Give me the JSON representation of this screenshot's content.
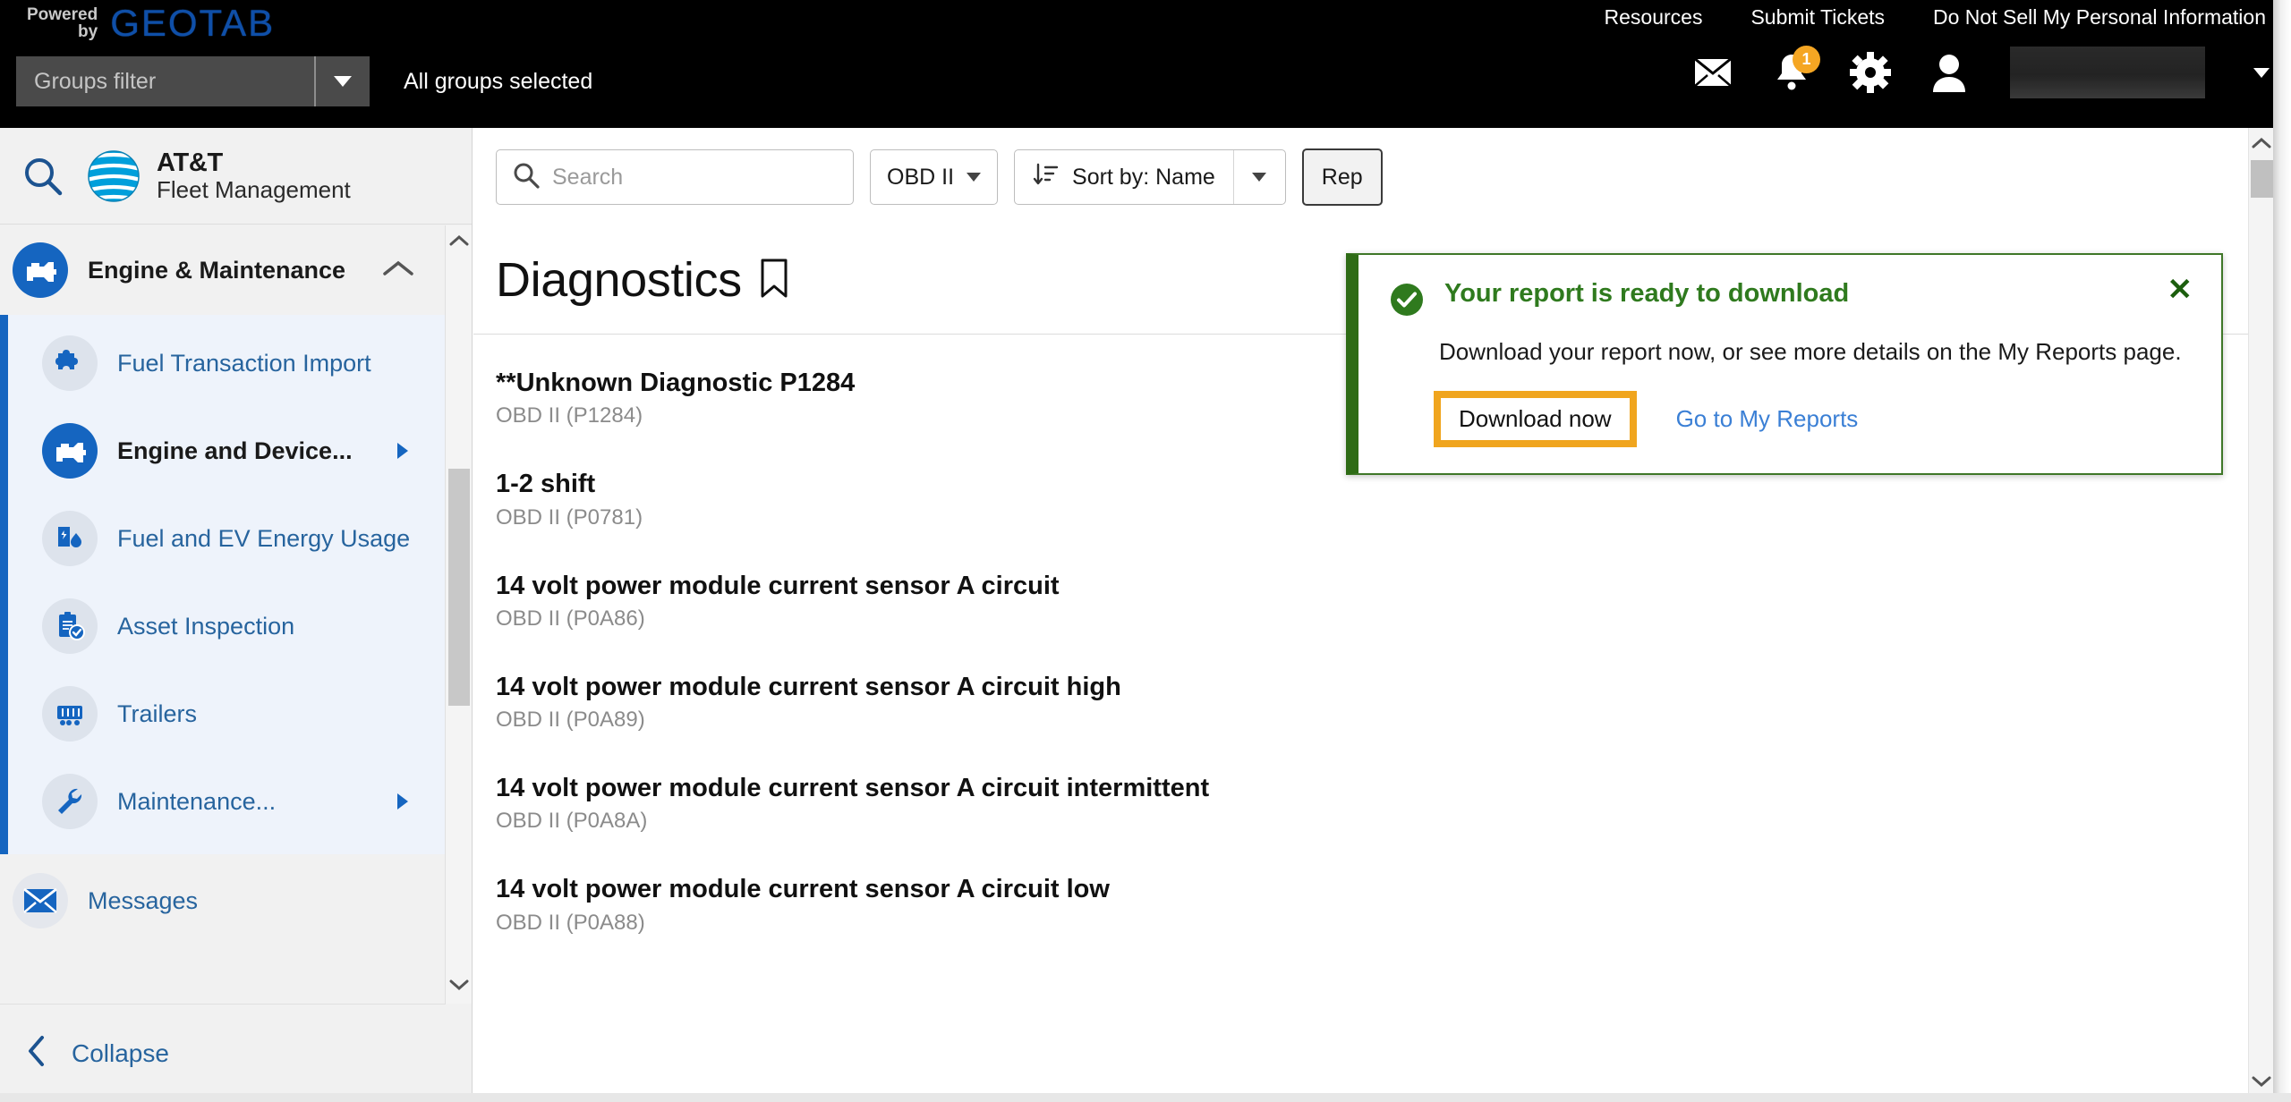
{
  "header": {
    "powered": "Powered",
    "by": "by",
    "brand_logo": "GEOTAB",
    "links": [
      {
        "label": "Resources"
      },
      {
        "label": "Submit Tickets"
      },
      {
        "label": "Do Not Sell My Personal Information"
      }
    ],
    "groups_filter_placeholder": "Groups filter",
    "groups_status": "All groups selected",
    "notification_count": "1",
    "icons": {
      "mail": "mail-icon",
      "bell": "bell-icon",
      "gear": "gear-icon",
      "user": "user-avatar-icon",
      "caret": "chevron-down-icon"
    },
    "user_name": ""
  },
  "sidebar": {
    "search_icon": "search-icon",
    "brand_line1": "AT&T",
    "brand_line2": "Fleet Management",
    "group": {
      "label": "Engine & Maintenance",
      "icon": "engine-icon",
      "expanded": true
    },
    "items": [
      {
        "label": "Fuel Transaction Import",
        "icon": "puzzle-icon",
        "active": false,
        "has_submenu": false
      },
      {
        "label": "Engine and Device...",
        "icon": "engine-icon",
        "active": true,
        "has_submenu": true
      },
      {
        "label": "Fuel and EV Energy Usage",
        "icon": "fuel-ev-icon",
        "active": false,
        "has_submenu": false
      },
      {
        "label": "Asset Inspection",
        "icon": "clipboard-check-icon",
        "active": false,
        "has_submenu": false
      },
      {
        "label": "Trailers",
        "icon": "trailer-icon",
        "active": false,
        "has_submenu": false
      },
      {
        "label": "Maintenance...",
        "icon": "wrench-icon",
        "active": false,
        "has_submenu": true
      }
    ],
    "messages": {
      "label": "Messages",
      "icon": "envelope-icon"
    },
    "collapse": {
      "label": "Collapse",
      "icon": "chevron-left-icon"
    }
  },
  "toolbar": {
    "search_placeholder": "Search",
    "search_value": "",
    "filter_label": "OBD II",
    "sort_label": "Sort by:  Name",
    "report_label": "Rep"
  },
  "main": {
    "title": "Diagnostics",
    "bookmark_icon": "bookmark-icon",
    "items": [
      {
        "name": "**Unknown Diagnostic P1284",
        "sub": "OBD II (P1284)"
      },
      {
        "name": "1-2 shift",
        "sub": "OBD II (P0781)"
      },
      {
        "name": "14 volt power module current sensor A circuit",
        "sub": "OBD II (P0A86)"
      },
      {
        "name": "14 volt power module current sensor A circuit high",
        "sub": "OBD II (P0A89)"
      },
      {
        "name": "14 volt power module current sensor A circuit intermittent",
        "sub": "OBD II (P0A8A)"
      },
      {
        "name": "14 volt power module current sensor A circuit low",
        "sub": "OBD II (P0A88)"
      }
    ]
  },
  "toast": {
    "status_icon": "check-circle-icon",
    "title": "Your report is ready to download",
    "body": "Download your report now, or see more details on the My Reports page.",
    "primary_label": "Download now",
    "link_label": "Go to My Reports",
    "close_icon": "close-icon",
    "accent_color": "#2f7a1e",
    "highlight_color": "#f0a51e"
  }
}
